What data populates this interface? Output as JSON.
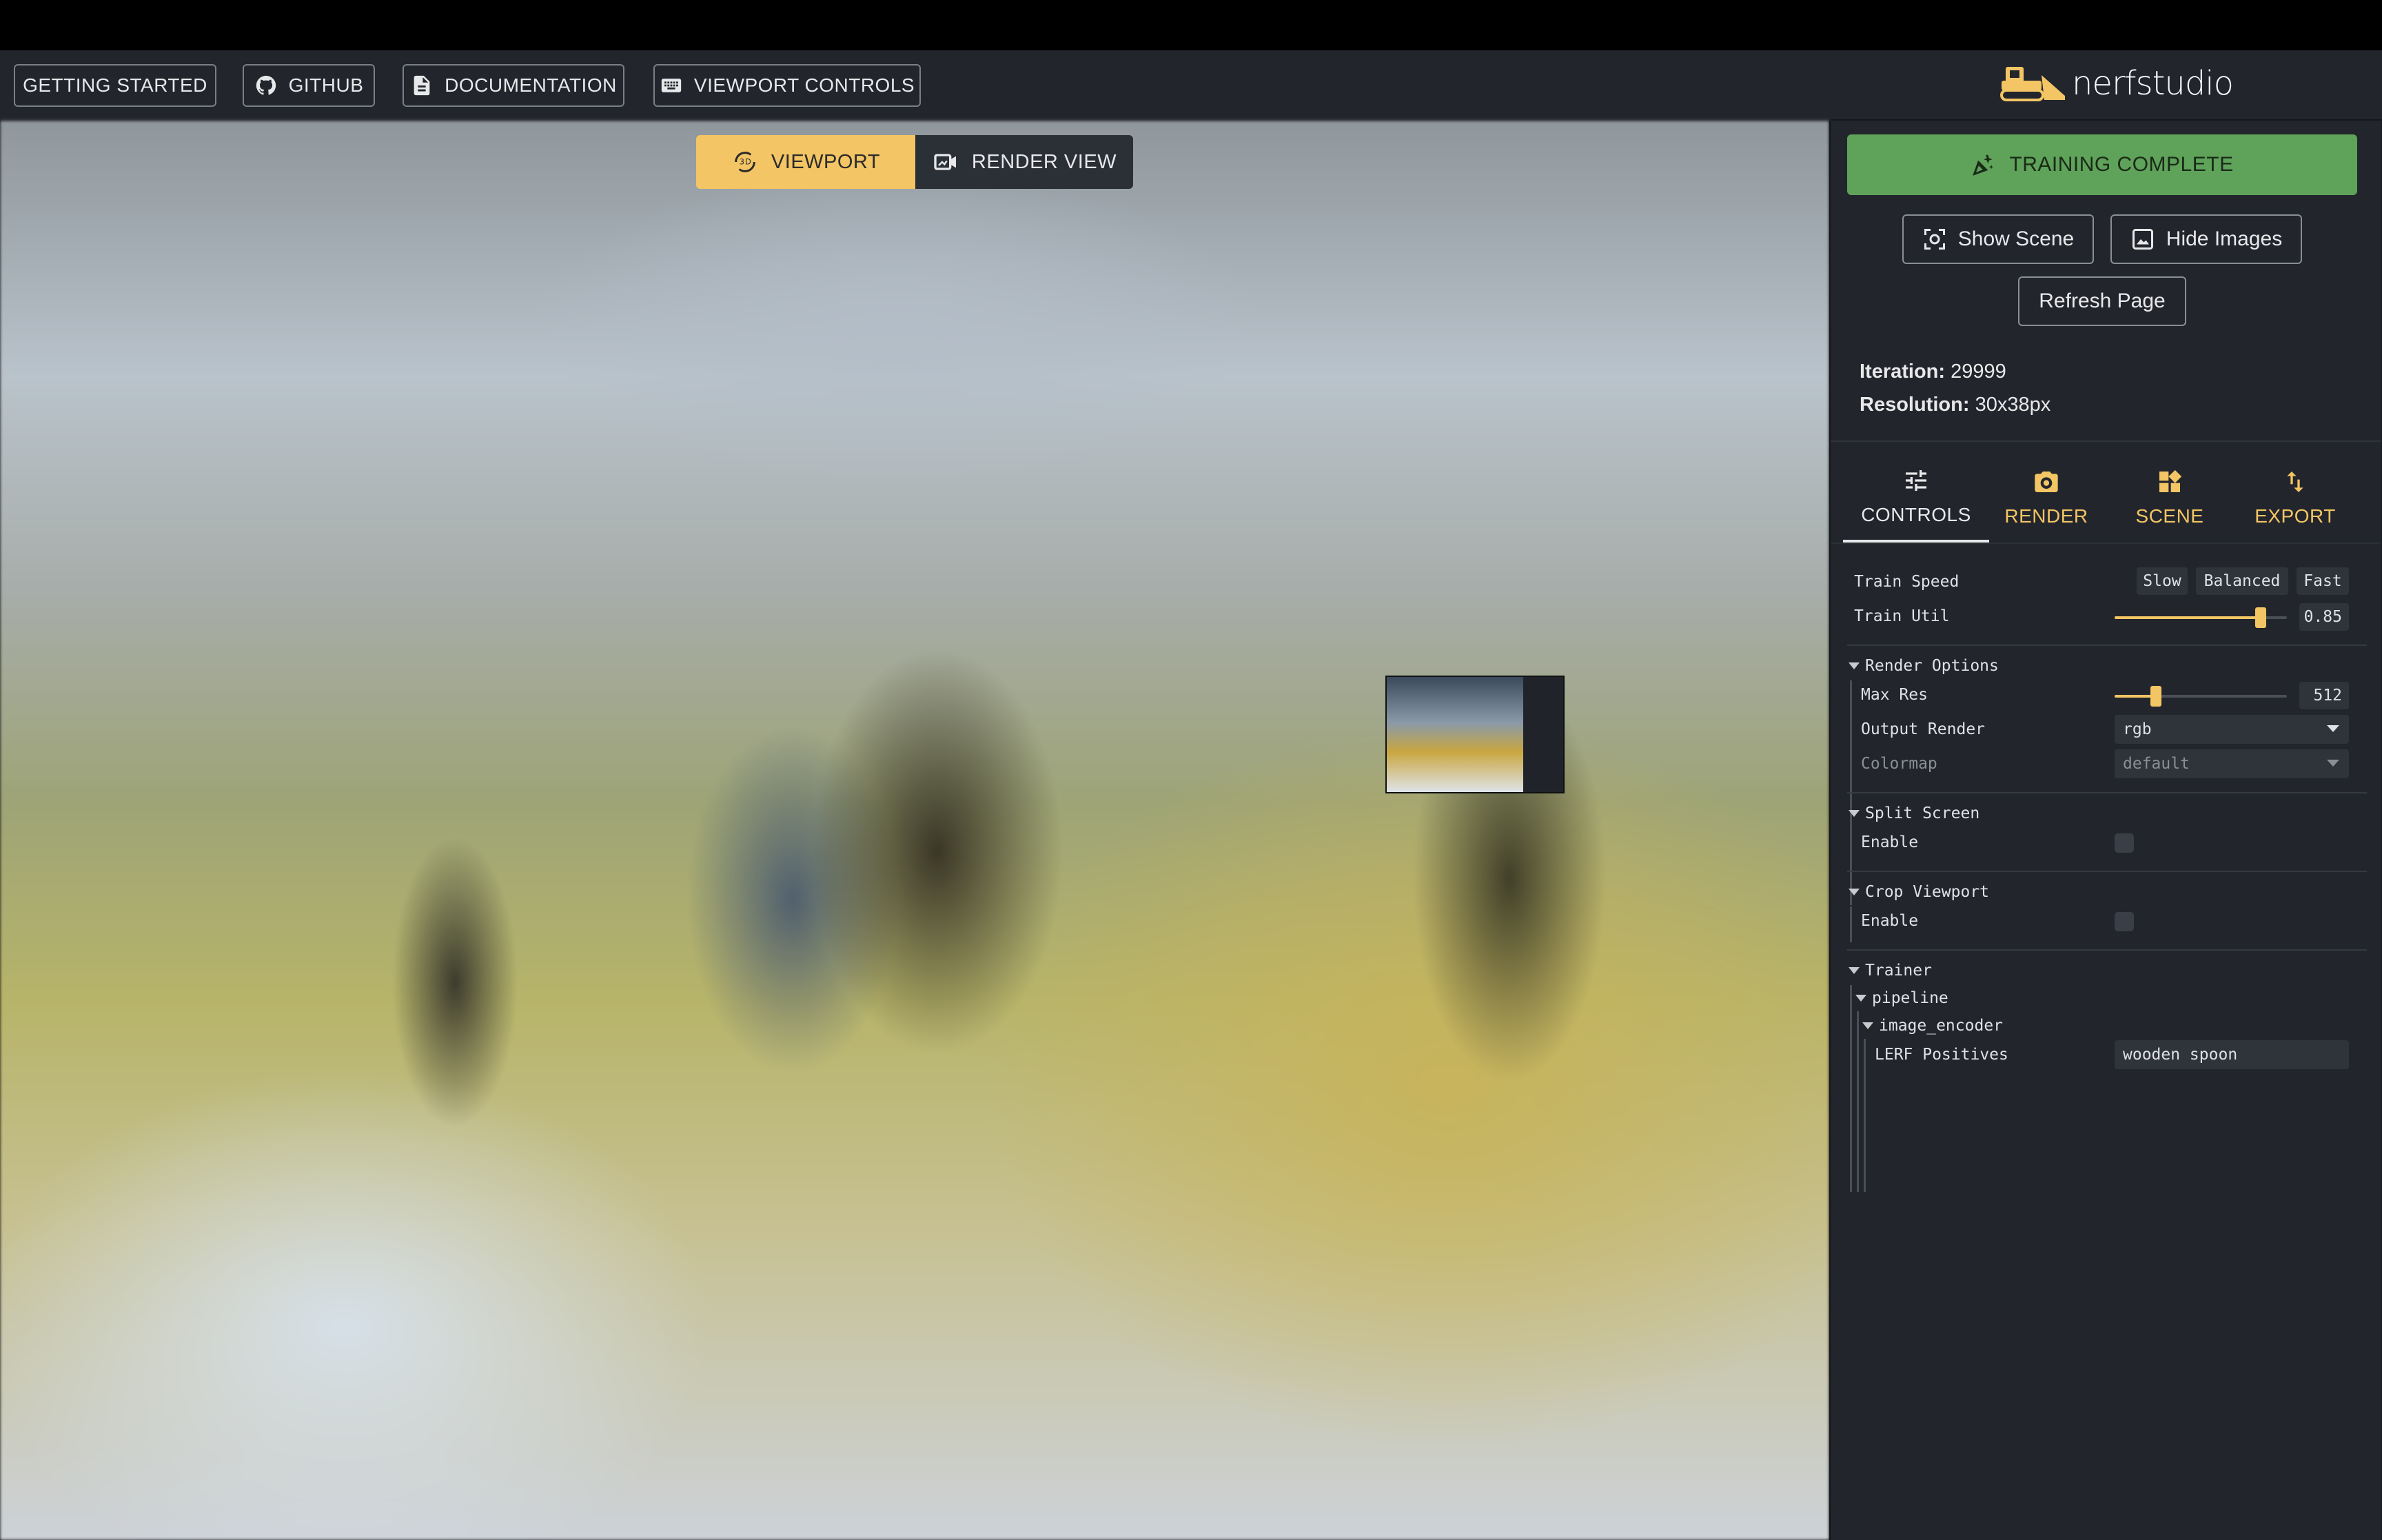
{
  "header": {
    "buttons": [
      "GETTING STARTED",
      "GITHUB",
      "DOCUMENTATION",
      "VIEWPORT CONTROLS"
    ],
    "logo_text": "nerfstudio"
  },
  "viewport": {
    "tabs": [
      "VIEWPORT",
      "RENDER VIEW"
    ],
    "active_tab": "VIEWPORT"
  },
  "panel": {
    "training_button": "TRAINING COMPLETE",
    "show_scene": "Show Scene",
    "hide_images": "Hide Images",
    "refresh_page": "Refresh Page",
    "iteration_label": "Iteration:",
    "iteration_value": "29999",
    "resolution_label": "Resolution:",
    "resolution_value": "30x38px",
    "tabs": [
      "CONTROLS",
      "RENDER",
      "SCENE",
      "EXPORT"
    ],
    "active_tab": "CONTROLS",
    "accent_color": "#f3c564",
    "success_color": "#5fa25a"
  },
  "controls": {
    "train_speed_label": "Train Speed",
    "train_speed_options": [
      "Slow",
      "Balanced",
      "Fast"
    ],
    "train_util_label": "Train Util",
    "train_util_value": "0.85",
    "render_options_label": "Render Options",
    "max_res_label": "Max Res",
    "max_res_value": "512",
    "output_render_label": "Output Render",
    "output_render_value": "rgb",
    "colormap_label": "Colormap",
    "colormap_value": "default",
    "split_screen_label": "Split Screen",
    "split_enable_label": "Enable",
    "crop_viewport_label": "Crop Viewport",
    "crop_enable_label": "Enable",
    "trainer_label": "Trainer",
    "pipeline_label": "pipeline",
    "image_encoder_label": "image_encoder",
    "lerf_label": "LERF Positives",
    "lerf_value": "wooden spoon"
  }
}
